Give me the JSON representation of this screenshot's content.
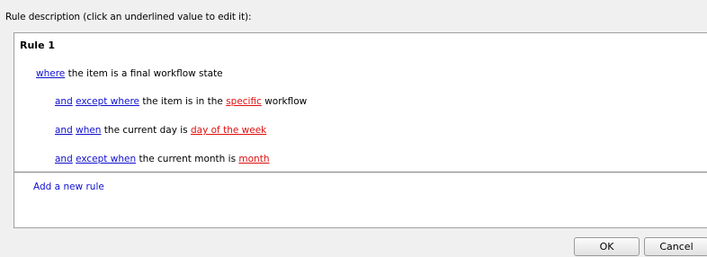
{
  "dialog": {
    "description_label": "Rule description (click an underlined value to edit it):"
  },
  "rule": {
    "title": "Rule 1",
    "lines": [
      {
        "kw1": "where",
        "text1": " the item is a final workflow state"
      },
      {
        "kw1": "and",
        "kw2": "except where",
        "text1": " the item is in the ",
        "value": "specific",
        "text2": " workflow"
      },
      {
        "kw1": "and",
        "kw2": "when",
        "text1": " the current day is ",
        "value": "day of the week"
      },
      {
        "kw1": "and",
        "kw2": "except when",
        "text1": " the current month is ",
        "value": "month"
      }
    ],
    "add_rule_label": "Add a new rule"
  },
  "buttons": {
    "ok": "OK",
    "cancel": "Cancel"
  },
  "colors": {
    "keyword": "#1010d0",
    "value": "#e01010"
  }
}
